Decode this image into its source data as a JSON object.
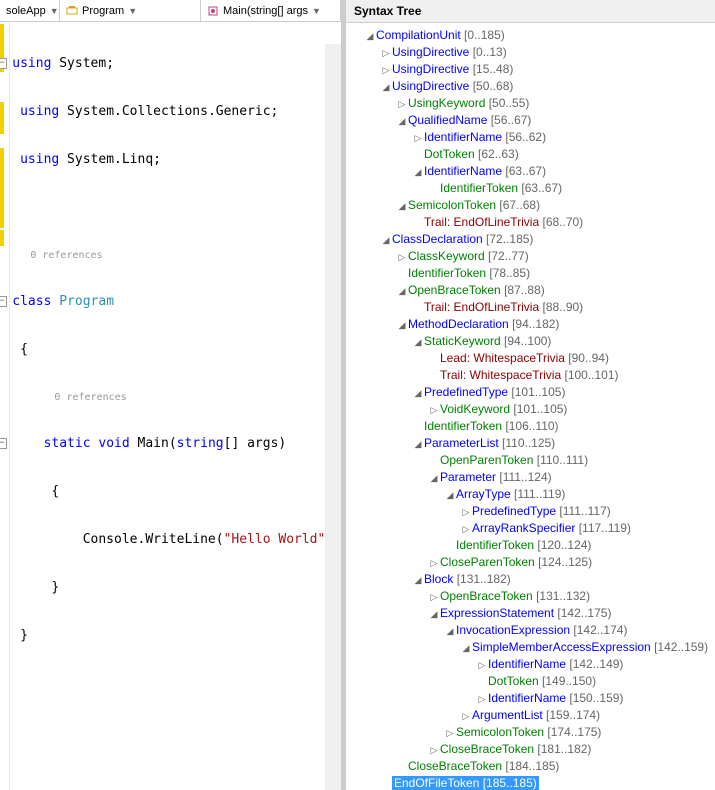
{
  "nav": {
    "left": "soleApp",
    "mid_icon": "class",
    "mid": "Program",
    "right_icon": "method",
    "right": "Main(string[] args"
  },
  "code": {
    "refs0": "0 references",
    "refs1": "0 references",
    "l1_kw": "using",
    "l1_b": " System;",
    "l2_kw": "using",
    "l2_b": " System.Collections.Generic;",
    "l3_kw": "using",
    "l3_b": " System.Linq;",
    "l5_kw": "class",
    "l5_cls": " Program",
    "l6": "{",
    "l8_kw1": "static",
    "l8_kw2": "void",
    "l8_m": " Main(",
    "l8_kw3": "string",
    "l8_r": "[] args)",
    "l9": "    {",
    "l10_a": "        Console.WriteLine(",
    "l10_str": "\"Hello World\"",
    "l10_b": ");",
    "l11": "    }",
    "l12": "}"
  },
  "syntax_tree_title": "Syntax Tree",
  "tree": [
    {
      "d": 1,
      "t": "e",
      "c": "blue",
      "n": "CompilationUnit",
      "r": "[0..185)"
    },
    {
      "d": 2,
      "t": "c",
      "c": "blue",
      "n": "UsingDirective",
      "r": "[0..13)"
    },
    {
      "d": 2,
      "t": "c",
      "c": "blue",
      "n": "UsingDirective",
      "r": "[15..48)"
    },
    {
      "d": 2,
      "t": "e",
      "c": "blue",
      "n": "UsingDirective",
      "r": "[50..68)"
    },
    {
      "d": 3,
      "t": "c",
      "c": "green",
      "n": "UsingKeyword",
      "r": "[50..55)"
    },
    {
      "d": 3,
      "t": "e",
      "c": "blue",
      "n": "QualifiedName",
      "r": "[56..67)"
    },
    {
      "d": 4,
      "t": "c",
      "c": "blue",
      "n": "IdentifierName",
      "r": "[56..62)"
    },
    {
      "d": 4,
      "t": "",
      "c": "green",
      "n": "DotToken",
      "r": "[62..63)"
    },
    {
      "d": 4,
      "t": "e",
      "c": "blue",
      "n": "IdentifierName",
      "r": "[63..67)"
    },
    {
      "d": 5,
      "t": "",
      "c": "green",
      "n": "IdentifierToken",
      "r": "[63..67)"
    },
    {
      "d": 3,
      "t": "e",
      "c": "green",
      "n": "SemicolonToken",
      "r": "[67..68)"
    },
    {
      "d": 4,
      "t": "",
      "c": "maroon",
      "n": "Trail: EndOfLineTrivia",
      "r": "[68..70)"
    },
    {
      "d": 2,
      "t": "e",
      "c": "blue",
      "n": "ClassDeclaration",
      "r": "[72..185)"
    },
    {
      "d": 3,
      "t": "c",
      "c": "green",
      "n": "ClassKeyword",
      "r": "[72..77)"
    },
    {
      "d": 3,
      "t": "",
      "c": "green",
      "n": "IdentifierToken",
      "r": "[78..85)"
    },
    {
      "d": 3,
      "t": "e",
      "c": "green",
      "n": "OpenBraceToken",
      "r": "[87..88)"
    },
    {
      "d": 4,
      "t": "",
      "c": "maroon",
      "n": "Trail: EndOfLineTrivia",
      "r": "[88..90)"
    },
    {
      "d": 3,
      "t": "e",
      "c": "blue",
      "n": "MethodDeclaration",
      "r": "[94..182)"
    },
    {
      "d": 4,
      "t": "e",
      "c": "green",
      "n": "StaticKeyword",
      "r": "[94..100)"
    },
    {
      "d": 5,
      "t": "",
      "c": "maroon",
      "n": "Lead: WhitespaceTrivia",
      "r": "[90..94)"
    },
    {
      "d": 5,
      "t": "",
      "c": "maroon",
      "n": "Trail: WhitespaceTrivia",
      "r": "[100..101)"
    },
    {
      "d": 4,
      "t": "e",
      "c": "blue",
      "n": "PredefinedType",
      "r": "[101..105)"
    },
    {
      "d": 5,
      "t": "c",
      "c": "green",
      "n": "VoidKeyword",
      "r": "[101..105)"
    },
    {
      "d": 4,
      "t": "",
      "c": "green",
      "n": "IdentifierToken",
      "r": "[106..110)"
    },
    {
      "d": 4,
      "t": "e",
      "c": "blue",
      "n": "ParameterList",
      "r": "[110..125)"
    },
    {
      "d": 5,
      "t": "",
      "c": "green",
      "n": "OpenParenToken",
      "r": "[110..111)"
    },
    {
      "d": 5,
      "t": "e",
      "c": "blue",
      "n": "Parameter",
      "r": "[111..124)"
    },
    {
      "d": 6,
      "t": "e",
      "c": "blue",
      "n": "ArrayType",
      "r": "[111..119)"
    },
    {
      "d": 7,
      "t": "c",
      "c": "blue",
      "n": "PredefinedType",
      "r": "[111..117)"
    },
    {
      "d": 7,
      "t": "c",
      "c": "blue",
      "n": "ArrayRankSpecifier",
      "r": "[117..119)"
    },
    {
      "d": 6,
      "t": "",
      "c": "green",
      "n": "IdentifierToken",
      "r": "[120..124)"
    },
    {
      "d": 5,
      "t": "c",
      "c": "green",
      "n": "CloseParenToken",
      "r": "[124..125)"
    },
    {
      "d": 4,
      "t": "e",
      "c": "blue",
      "n": "Block",
      "r": "[131..182)"
    },
    {
      "d": 5,
      "t": "c",
      "c": "green",
      "n": "OpenBraceToken",
      "r": "[131..132)"
    },
    {
      "d": 5,
      "t": "e",
      "c": "blue",
      "n": "ExpressionStatement",
      "r": "[142..175)"
    },
    {
      "d": 6,
      "t": "e",
      "c": "blue",
      "n": "InvocationExpression",
      "r": "[142..174)"
    },
    {
      "d": 7,
      "t": "e",
      "c": "blue",
      "n": "SimpleMemberAccessExpression",
      "r": "[142..159)"
    },
    {
      "d": 8,
      "t": "c",
      "c": "blue",
      "n": "IdentifierName",
      "r": "[142..149)"
    },
    {
      "d": 8,
      "t": "",
      "c": "green",
      "n": "DotToken",
      "r": "[149..150)"
    },
    {
      "d": 8,
      "t": "c",
      "c": "blue",
      "n": "IdentifierName",
      "r": "[150..159)"
    },
    {
      "d": 7,
      "t": "c",
      "c": "blue",
      "n": "ArgumentList",
      "r": "[159..174)"
    },
    {
      "d": 6,
      "t": "c",
      "c": "green",
      "n": "SemicolonToken",
      "r": "[174..175)"
    },
    {
      "d": 5,
      "t": "c",
      "c": "green",
      "n": "CloseBraceToken",
      "r": "[181..182)"
    },
    {
      "d": 3,
      "t": "",
      "c": "green",
      "n": "CloseBraceToken",
      "r": "[184..185)"
    },
    {
      "d": 2,
      "t": "",
      "c": "green",
      "n": "EndOfFileToken",
      "r": "[185..185)",
      "sel": true
    }
  ]
}
